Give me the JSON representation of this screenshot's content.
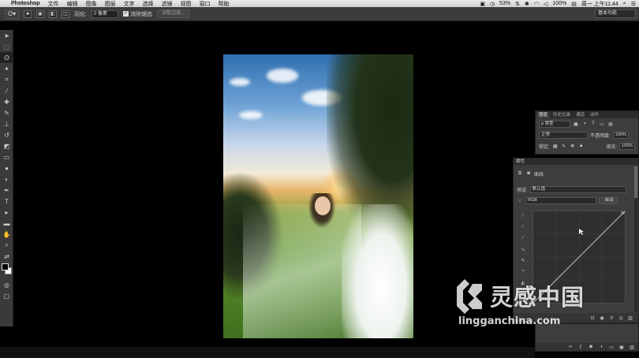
{
  "menubar": {
    "app": "Photoshop",
    "items": [
      "文件",
      "编辑",
      "图像",
      "图层",
      "文字",
      "选择",
      "滤镜",
      "视图",
      "窗口",
      "帮助"
    ],
    "battery": "53%",
    "battery2": "100%",
    "datetime": "周一 上午11:44"
  },
  "options": {
    "feather_label": "羽化:",
    "feather_value": "0 像素",
    "antialias_label": "消除锯齿",
    "refine_edge": "调整边缘...",
    "workspace": "基本功能"
  },
  "layers_panel": {
    "tabs": [
      "图层",
      "历史记录",
      "通道",
      "动作"
    ],
    "kind": "ρ 类型",
    "blend_mode": "正常",
    "opacity_label": "不透明度:",
    "opacity_value": "100%",
    "lock_label": "锁定:",
    "fill_label": "填充:",
    "fill_value": "100%"
  },
  "properties_panel": {
    "title": "属性",
    "adjustment": "曲线",
    "preset_label": "预设:",
    "preset_value": "默认值",
    "channel": "RGB",
    "auto_button": "自动"
  },
  "watermark": {
    "brand": "灵感中国",
    "url": "lingganchina.com"
  },
  "colors": {
    "panel_bg": "#3d3d3d",
    "canvas_bg": "#000000",
    "menubar_bg": "#dcdcdc"
  }
}
